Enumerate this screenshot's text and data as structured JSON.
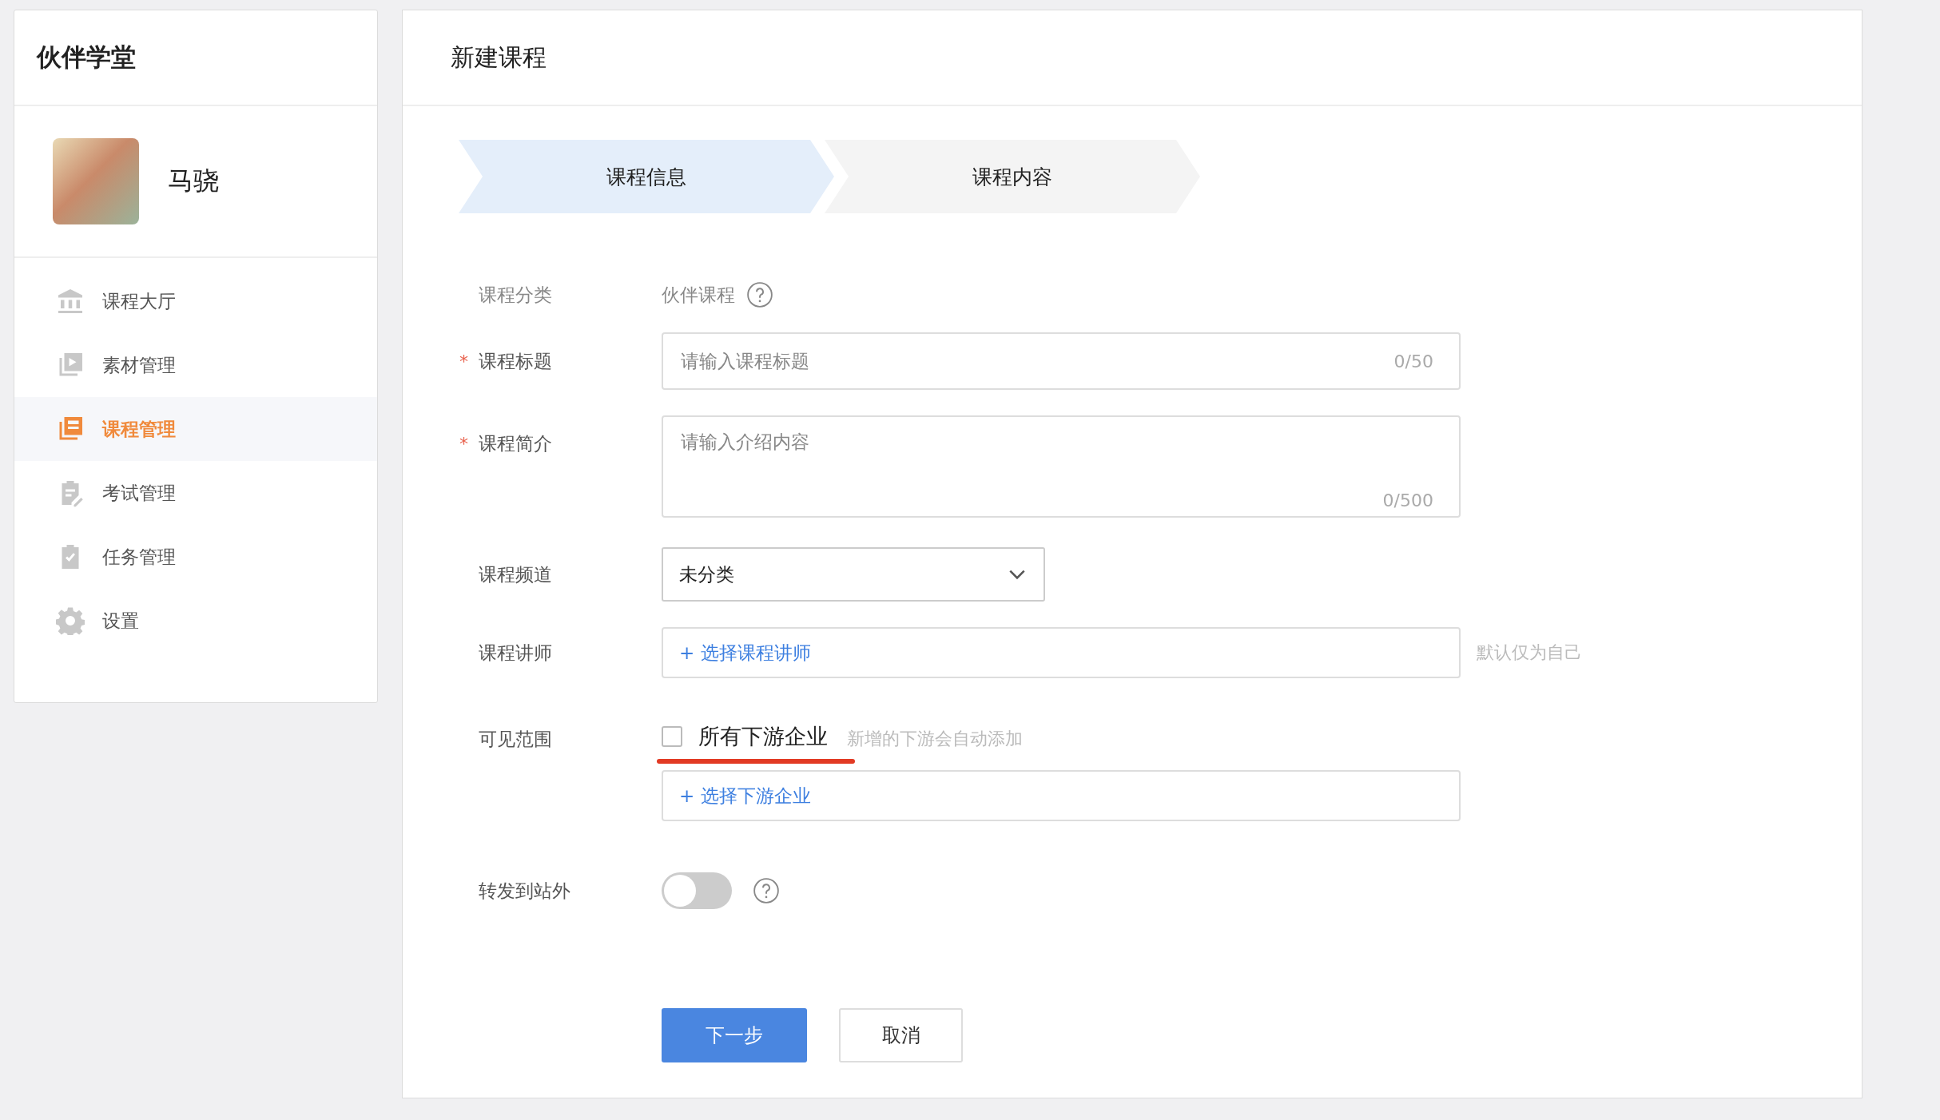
{
  "app": {
    "title": "伙伴学堂"
  },
  "user": {
    "name": "马骁"
  },
  "nav": [
    {
      "label": "课程大厅",
      "selected": false
    },
    {
      "label": "素材管理",
      "selected": false
    },
    {
      "label": "课程管理",
      "selected": true
    },
    {
      "label": "考试管理",
      "selected": false
    },
    {
      "label": "任务管理",
      "selected": false
    },
    {
      "label": "设置",
      "selected": false
    }
  ],
  "page": {
    "title": "新建课程"
  },
  "steps": [
    {
      "label": "课程信息",
      "selected": true
    },
    {
      "label": "课程内容",
      "selected": false
    }
  ],
  "form": {
    "rows": [
      {
        "kind": "static",
        "label": "课程分类",
        "value": "伙伴课程",
        "help": true
      },
      {
        "kind": "input",
        "label": "课程标题",
        "required_mark": "*",
        "placeholder": "请输入课程标题",
        "counter": "0/50"
      },
      {
        "kind": "textarea",
        "label": "课程简介",
        "required_mark": "*",
        "placeholder": "请输入介绍内容",
        "counter": "0/500"
      },
      {
        "kind": "select",
        "label": "课程频道",
        "value": "未分类"
      },
      {
        "kind": "picker",
        "label": "课程讲师",
        "link": "+ 选择课程讲师",
        "hint": "默认仅为自己"
      },
      {
        "kind": "scope",
        "label": "可见范围",
        "checkbox": {
          "label": "所有下游企业",
          "checked": false
        },
        "hint": "新增的下游会自动添加",
        "link": "+ 选择下游企业"
      },
      {
        "kind": "toggle",
        "label": "转发到站外",
        "on": false,
        "help": true
      }
    ]
  },
  "buttons": [
    {
      "label": "下一步",
      "kind": "primary"
    },
    {
      "label": "取消",
      "kind": "secondary"
    }
  ]
}
